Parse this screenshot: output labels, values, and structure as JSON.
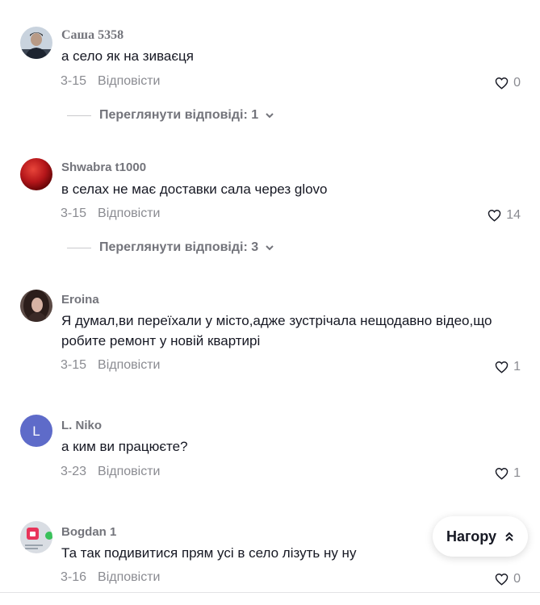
{
  "comments": [
    {
      "author": "Саша 5358",
      "text": "а село як на зиваєця",
      "date": "3-15",
      "reply": "Відповісти",
      "likes": "0",
      "view_replies": "Переглянути відповіді: 1",
      "avatar_icon": "user-photo-avatar"
    },
    {
      "author": "Shwabra t1000",
      "text": "в селах не має доставки сала через glovo",
      "date": "3-15",
      "reply": "Відповісти",
      "likes": "14",
      "view_replies": "Переглянути відповіді: 3",
      "avatar_icon": "red-sphere-avatar"
    },
    {
      "author": "Eroina",
      "text": "Я думал,ви переїхали у місто,адже зустрічала нещодавно відео,що робите ремонт у новій квартирі",
      "date": "3-15",
      "reply": "Відповісти",
      "likes": "1",
      "avatar_icon": "user-photo-avatar"
    },
    {
      "author": "L. Niko",
      "text": "а ким ви працюєте?",
      "date": "3-23",
      "reply": "Відповісти",
      "likes": "1",
      "avatar_letter": "L",
      "avatar_color": "#5e6bc9"
    },
    {
      "author": "Bogdan 1",
      "text": "Та так подивитися прям усі в село лізуть ну ну",
      "date": "3-16",
      "reply": "Відповісти",
      "likes": "0",
      "avatar_icon": "app-icon-avatar"
    }
  ],
  "scroll_top": {
    "label": "Нагору",
    "icon": "double-chevron-up-icon"
  },
  "colors": {
    "text": "#161823",
    "secondary": "#8a8b91",
    "author": "#73747b"
  }
}
